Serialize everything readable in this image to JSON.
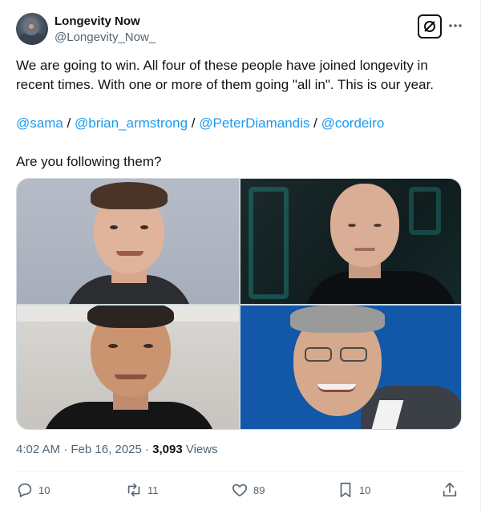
{
  "author": {
    "display_name": "Longevity Now",
    "handle": "@Longevity_Now_"
  },
  "tweet": {
    "line1": "We are going to win. All four of these people have joined longevity in recent times. With one or more of them going \"all in\". This is our year.",
    "mentions": [
      "@sama",
      "@brian_armstrong",
      "@PeterDiamandis",
      "@cordeiro"
    ],
    "separator": " / ",
    "question": "Are you following them?"
  },
  "meta": {
    "time": "4:02 AM",
    "dot": "·",
    "date": "Feb 16, 2025",
    "views_count": "3,093",
    "views_label": "Views"
  },
  "actions": {
    "replies": "10",
    "reposts": "11",
    "likes": "89",
    "bookmarks": "10"
  },
  "icons": {
    "grok": "grok-slash-icon",
    "more": "more-dots-icon",
    "reply": "reply-bubble-icon",
    "repost": "repost-arrows-icon",
    "like": "heart-icon",
    "bookmark": "bookmark-icon",
    "share": "share-upload-icon"
  },
  "colors": {
    "link": "#1d9bf0",
    "text": "#0f1419",
    "muted": "#536471"
  }
}
